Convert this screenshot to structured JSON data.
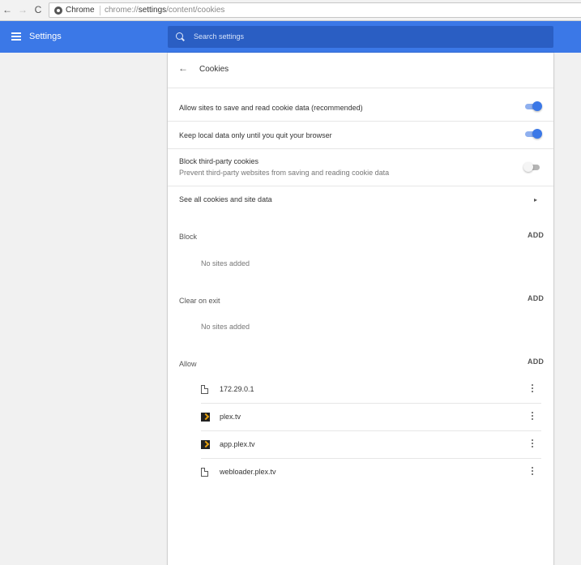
{
  "browser": {
    "site_chip": "Chrome",
    "url_scheme": "chrome://",
    "url_host": "settings",
    "url_path": "/content/cookies",
    "nav_back": "←",
    "nav_forward": "→",
    "nav_reload": "C"
  },
  "header": {
    "title": "Settings",
    "search_placeholder": "Search settings"
  },
  "page": {
    "back_glyph": "←",
    "title": "Cookies"
  },
  "settings": {
    "allow_save": {
      "label": "Allow sites to save and read cookie data (recommended)",
      "enabled": true
    },
    "keep_local": {
      "label": "Keep local data only until you quit your browser",
      "enabled": true
    },
    "block_third_party": {
      "label": "Block third-party cookies",
      "description": "Prevent third-party websites from saving and reading cookie data",
      "enabled": false
    },
    "see_all": {
      "label": "See all cookies and site data",
      "chevron": "▸"
    }
  },
  "sections": {
    "block": {
      "label": "Block",
      "add": "ADD",
      "empty": "No sites added"
    },
    "clear_on_exit": {
      "label": "Clear on exit",
      "add": "ADD",
      "empty": "No sites added"
    },
    "allow": {
      "label": "Allow",
      "add": "ADD",
      "sites": [
        {
          "name": "172.29.0.1",
          "icon": "file-icon"
        },
        {
          "name": "plex.tv",
          "icon": "plex-icon"
        },
        {
          "name": "app.plex.tv",
          "icon": "plex-icon"
        },
        {
          "name": "webloader.plex.tv",
          "icon": "file-icon"
        }
      ]
    }
  },
  "colors": {
    "accent": "#3b78e7",
    "search_bg": "#2a5ec3",
    "plex_orange": "#e5a00d"
  }
}
